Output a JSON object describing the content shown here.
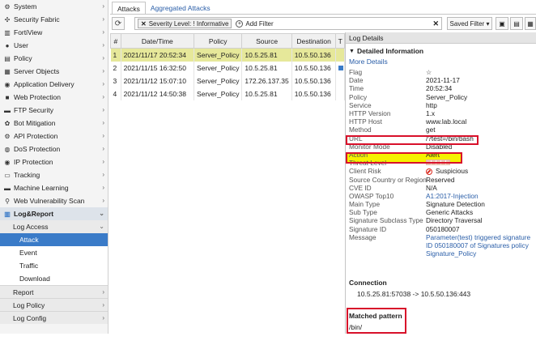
{
  "sidebar": {
    "items": [
      {
        "label": "System",
        "icon": "gear-icon",
        "glyph": "⚙"
      },
      {
        "label": "Security Fabric",
        "icon": "fabric-icon",
        "glyph": "✣"
      },
      {
        "label": "FortiView",
        "icon": "chart-icon",
        "glyph": "▥"
      },
      {
        "label": "User",
        "icon": "user-icon",
        "glyph": "●"
      },
      {
        "label": "Policy",
        "icon": "policy-icon",
        "glyph": "▤"
      },
      {
        "label": "Server Objects",
        "icon": "server-icon",
        "glyph": "▦"
      },
      {
        "label": "Application Delivery",
        "icon": "delivery-icon",
        "glyph": "◉"
      },
      {
        "label": "Web Protection",
        "icon": "lock-icon",
        "glyph": "■"
      },
      {
        "label": "FTP Security",
        "icon": "folder-icon",
        "glyph": "▬"
      },
      {
        "label": "Bot Mitigation",
        "icon": "bot-icon",
        "glyph": "✿"
      },
      {
        "label": "API Protection",
        "icon": "api-icon",
        "glyph": "⚙"
      },
      {
        "label": "DoS Protection",
        "icon": "shield-icon",
        "glyph": "◍"
      },
      {
        "label": "IP Protection",
        "icon": "ip-icon",
        "glyph": "◉"
      },
      {
        "label": "Tracking",
        "icon": "tracking-icon",
        "glyph": "▭"
      },
      {
        "label": "Machine Learning",
        "icon": "ml-icon",
        "glyph": "▬"
      },
      {
        "label": "Web Vulnerability Scan",
        "icon": "scan-icon",
        "glyph": "⚲"
      }
    ],
    "log_report": {
      "label": "Log&Report",
      "icon": "report-icon",
      "glyph": "▥"
    },
    "log_access": {
      "label": "Log Access"
    },
    "log_access_children": [
      "Attack",
      "Event",
      "Traffic",
      "Download"
    ],
    "bottom_items": [
      "Report",
      "Log Policy",
      "Log Config"
    ]
  },
  "tabs": [
    "Attacks",
    "Aggregated Attacks"
  ],
  "toolbar": {
    "filter_chip": "Severity Level: ! Informative",
    "add_filter": "Add Filter",
    "saved_filter": "Saved Filter ▾"
  },
  "table": {
    "headers": [
      "#",
      "Date/Time",
      "Policy",
      "Source",
      "Destination",
      "T"
    ],
    "rows": [
      {
        "n": "1",
        "datetime": "2021/11/17 20:52:34",
        "policy": "Server_Policy",
        "source": "10.5.25.81",
        "destination": "10.5.50.136",
        "selected": true
      },
      {
        "n": "2",
        "datetime": "2021/11/15 16:32:50",
        "policy": "Server_Policy",
        "source": "10.5.25.81",
        "destination": "10.5.50.136",
        "selected": false
      },
      {
        "n": "3",
        "datetime": "2021/11/12 15:07:10",
        "policy": "Server_Policy",
        "source": "172.26.137.35",
        "destination": "10.5.50.136",
        "selected": false
      },
      {
        "n": "4",
        "datetime": "2021/11/12 14:50:38",
        "policy": "Server_Policy",
        "source": "10.5.25.81",
        "destination": "10.5.50.136",
        "selected": false
      }
    ]
  },
  "details": {
    "header": "Log Details",
    "section": "Detailed Information",
    "more_details": "More Details",
    "fields": [
      {
        "k": "Flag",
        "v": "☆"
      },
      {
        "k": "Date",
        "v": "2021-11-17"
      },
      {
        "k": "Time",
        "v": "20:52:34"
      },
      {
        "k": "Policy",
        "v": "Server_Policy"
      },
      {
        "k": "Service",
        "v": "http"
      },
      {
        "k": "HTTP Version",
        "v": "1.x"
      },
      {
        "k": "HTTP Host",
        "v": "www.lab.local"
      },
      {
        "k": "Method",
        "v": "get"
      },
      {
        "k": "URL",
        "v": "/?test=/bin/bash"
      },
      {
        "k": "Monitor Mode",
        "v": "Disabled"
      },
      {
        "k": "Action",
        "v": "Alert"
      },
      {
        "k": "Threat Level",
        "v": ""
      },
      {
        "k": "Client Risk",
        "v": "Suspicious"
      },
      {
        "k": "Source Country or Region",
        "v": "Reserved"
      },
      {
        "k": "CVE ID",
        "v": "N/A"
      },
      {
        "k": "OWASP Top10",
        "v": "A1:2017-Injection"
      },
      {
        "k": "Main Type",
        "v": "Signature Detection"
      },
      {
        "k": "Sub Type",
        "v": "Generic Attacks"
      },
      {
        "k": "Signature Subclass Type",
        "v": "Directory Traversal"
      },
      {
        "k": "Signature ID",
        "v": "050180007"
      },
      {
        "k": "Message",
        "v": "Parameter(test) triggered signature ID 050180007 of Signatures policy Signature_Policy"
      }
    ],
    "connection_title": "Connection",
    "connection_value": "10.5.25.81:57038 -> 10.5.50.136:443",
    "matched_title": "Matched pattern",
    "matched_value": "/bin/"
  },
  "colors": {
    "accent": "#3a7bc8",
    "selected_row": "#e6e89a",
    "highlight": "#f5f200",
    "annotation": "#d8102a",
    "link": "#2a5ea8"
  }
}
